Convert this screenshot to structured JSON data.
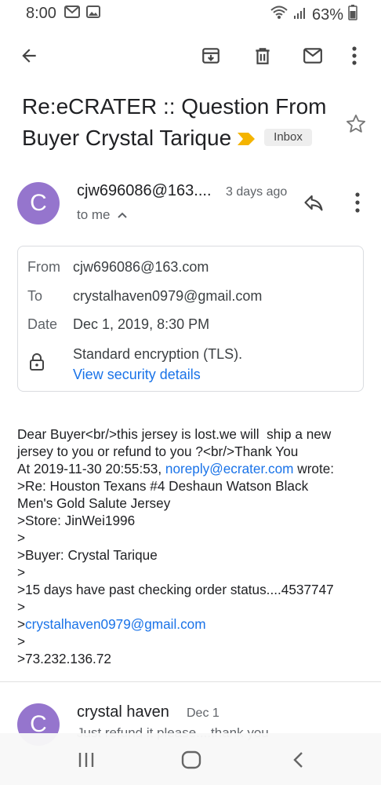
{
  "status_bar": {
    "time": "8:00",
    "battery": "63%",
    "icons": [
      "mail-notification-icon",
      "image-notification-icon",
      "wifi-icon",
      "signal-icon",
      "battery-icon"
    ]
  },
  "toolbar": {
    "icons": [
      "back-arrow-icon",
      "archive-icon",
      "delete-icon",
      "mark-unread-icon",
      "more-vert-icon"
    ]
  },
  "email": {
    "subject": "Re:eCRATER :: Question From Buyer Crystal Tarique",
    "label": "Inbox",
    "sender_initial": "C",
    "sender": "cjw696086@163....",
    "time": "3 days ago",
    "to": "to me"
  },
  "details": {
    "from_label": "From",
    "from_value": "cjw696086@163.com",
    "to_label": "To",
    "to_value": "crystalhaven0979@gmail.com",
    "date_label": "Date",
    "date_value": "Dec 1, 2019, 8:30 PM",
    "encryption": "Standard encryption (TLS).",
    "security_link": "View security details"
  },
  "body": {
    "line1": "Dear Buyer<br/>this jersey is lost.we will  ship a new",
    "line2": "jersey to you or refund to you ?<br/>Thank You",
    "line3_prefix": "At 2019-11-30 20:55:53, ",
    "line3_link": "noreply@ecrater.com",
    "line3_suffix": " wrote:",
    "line4": ">Re: Houston Texans #4 Deshaun Watson Black",
    "line5": "Men's Gold Salute Jersey",
    "line6": ">Store: JinWei1996",
    "line7": ">",
    "line8": ">Buyer: Crystal Tarique",
    "line9": ">",
    "line10": ">15 days have past checking order status....4537747",
    "line11": ">",
    "line12_prefix": ">",
    "line12_link": "crystalhaven0979@gmail.com",
    "line13": ">",
    "line14": ">73.232.136.72"
  },
  "next_message": {
    "initial": "C",
    "sender": "crystal haven",
    "date": "Dec 1",
    "snippet": "Just refund it please....thank you"
  },
  "navbar": {
    "icons": [
      "recents-icon",
      "home-icon",
      "back-icon"
    ]
  },
  "colors": {
    "avatar": "#9575cd",
    "link": "#1a73e8",
    "important_marker": "#f4b400"
  }
}
